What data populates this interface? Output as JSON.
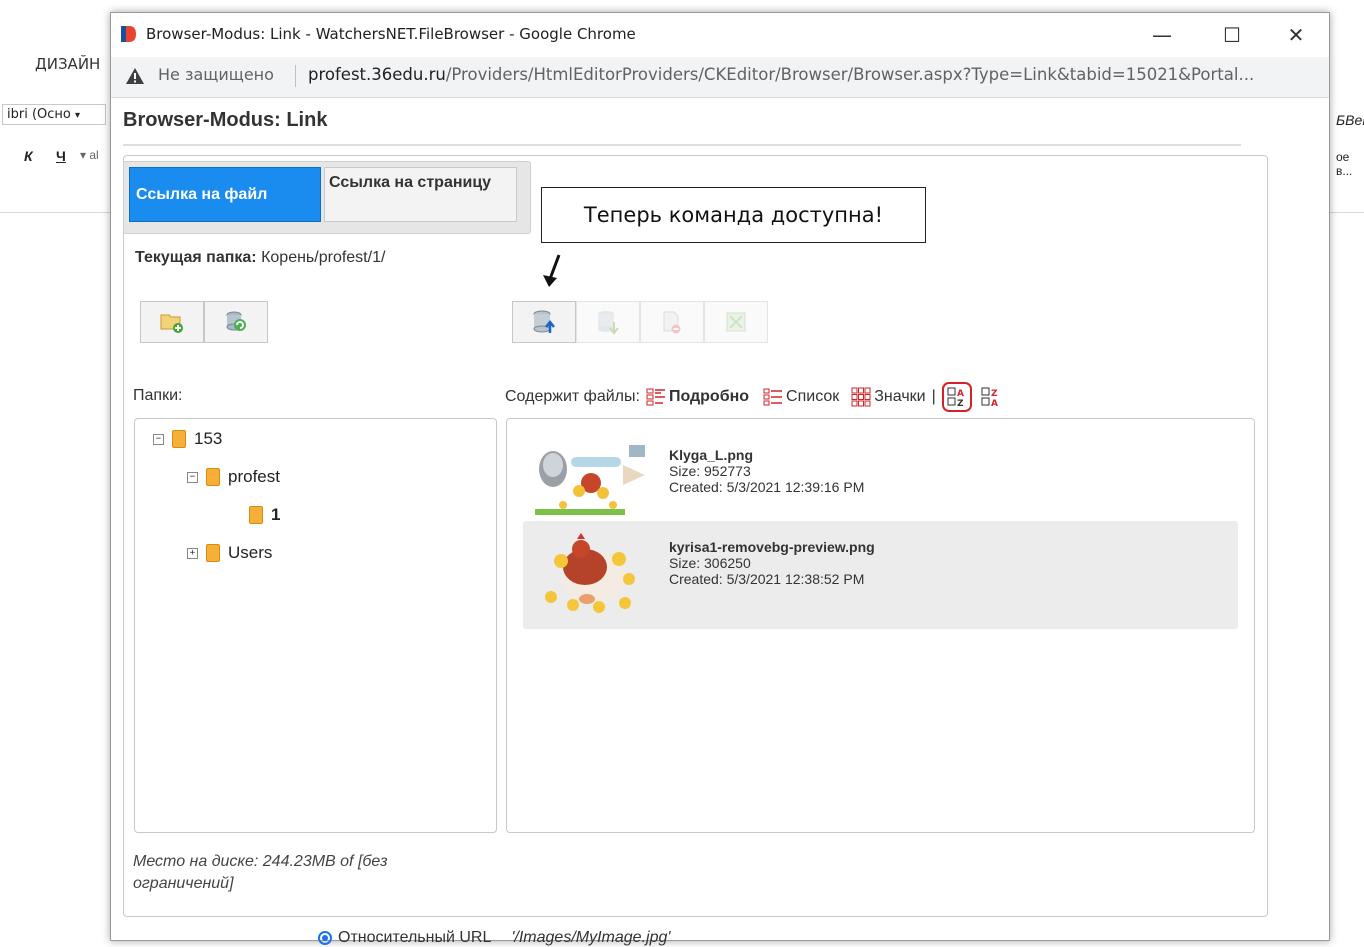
{
  "background_app": {
    "ribbon_tab": "ДИЗАЙН",
    "font_name": "ibri (Осно",
    "italic_label": "К",
    "underline_label": "Ч",
    "right_style_text": "БВеГ",
    "right_style_text2": "ое в..."
  },
  "window": {
    "title": "Browser-Modus: Link - WatchersNET.FileBrowser - Google Chrome",
    "minimize": "—",
    "maximize": "☐",
    "close": "✕",
    "security_label": "Не защищено",
    "url_host": "profest.36edu.ru",
    "url_path": "/Providers/HtmlEditorProviders/CKEditor/Browser/Browser.aspx?Type=Link&tabid=15021&Portal..."
  },
  "page": {
    "title": "Browser-Modus: Link",
    "tabs": [
      {
        "label": "Ссылка на файл",
        "active": true
      },
      {
        "label": "Ссылка на страницу",
        "active": false
      }
    ],
    "current_folder_label": "Текущая папка:",
    "current_folder_value": "Корень/profest/1/",
    "callout": "Теперь команда доступна!",
    "folders_label": "Папки:",
    "files_label": "Содержит файлы:",
    "view_options": [
      {
        "label": "Подробно",
        "icon": "details-view-icon",
        "bold": true
      },
      {
        "label": "Список",
        "icon": "list-view-icon",
        "bold": false
      },
      {
        "label": "Значки",
        "icon": "thumbnails-view-icon",
        "bold": false
      }
    ],
    "separator": "|",
    "tree": [
      {
        "label": "153",
        "toggle": "−",
        "bold": false
      },
      {
        "label": "profest",
        "toggle": "−",
        "bold": false
      },
      {
        "label": "1",
        "toggle": "",
        "bold": true
      },
      {
        "label": "Users",
        "toggle": "+",
        "bold": false
      }
    ],
    "files": [
      {
        "name": "Klyga_L.png",
        "size": "Size: 952773",
        "created": "Created: 5/3/2021 12:39:16 PM",
        "selected": false
      },
      {
        "name": "kyrisa1-removebg-preview.png",
        "size": "Size: 306250",
        "created": "Created: 5/3/2021 12:38:52 PM",
        "selected": true
      }
    ],
    "disk_space": "Место на диске: 244.23MB of [без ограничений]",
    "bottom_option": "Относительный URL",
    "bottom_example": "'/Images/MyImage.jpg'"
  },
  "colors": {
    "tab_active": "#1a8cf0",
    "folder": "#f6b03a",
    "selected_row": "#ececec",
    "sort_icon_red": "#d2232a"
  }
}
